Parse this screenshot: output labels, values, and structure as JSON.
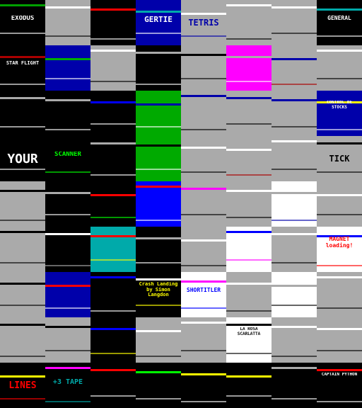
{
  "gallery": {
    "tiles": [
      {
        "label": "EXODUS",
        "bg": "#000000",
        "fg": "#ffffff",
        "accent": "#00a000",
        "size": 9
      },
      {
        "label": "",
        "bg": "#aaaaaa",
        "fg": "#000000",
        "accent": "#ffffff",
        "size": 6
      },
      {
        "label": "",
        "bg": "#000000",
        "fg": "#ffffff",
        "accent": "#ff0000",
        "size": 6
      },
      {
        "label": "GERTIE",
        "bg": "#0000aa",
        "fg": "#ffffff",
        "accent": "#00aaaa",
        "size": 11
      },
      {
        "label": "TETRIS",
        "bg": "#aaaaaa",
        "fg": "#0000aa",
        "accent": "#ffffff",
        "size": 12
      },
      {
        "label": "",
        "bg": "#aaaaaa",
        "fg": "#000000",
        "accent": "#ffffff",
        "size": 6
      },
      {
        "label": "",
        "bg": "#aaaaaa",
        "fg": "#000000",
        "accent": "#ffffff",
        "size": 6
      },
      {
        "label": "GENERAL",
        "bg": "#000000",
        "fg": "#ffffff",
        "accent": "#00aaaa",
        "size": 8
      },
      {
        "label": "STAR FLIGHT",
        "bg": "#000000",
        "fg": "#ffffff",
        "accent": "#aa0000",
        "size": 7
      },
      {
        "label": "",
        "bg": "#0000aa",
        "fg": "#ffffff",
        "accent": "#00aa00",
        "size": 6
      },
      {
        "label": "",
        "bg": "#aaaaaa",
        "fg": "#000000",
        "accent": "#ffffff",
        "size": 6
      },
      {
        "label": "",
        "bg": "#000000",
        "fg": "#ffffff",
        "accent": "#aaaaaa",
        "size": 6
      },
      {
        "label": "",
        "bg": "#aaaaaa",
        "fg": "#000000",
        "accent": "#000000",
        "size": 6
      },
      {
        "label": "",
        "bg": "#ff00ff",
        "fg": "#ffffff",
        "accent": "#aaaaaa",
        "size": 6
      },
      {
        "label": "",
        "bg": "#aaaaaa",
        "fg": "#aa0000",
        "accent": "#0000aa",
        "size": 6
      },
      {
        "label": "",
        "bg": "#aaaaaa",
        "fg": "#000000",
        "accent": "#ffffff",
        "size": 6
      },
      {
        "label": "",
        "bg": "#000000",
        "fg": "#ffffff",
        "accent": "#aaaaaa",
        "size": 6
      },
      {
        "label": "",
        "bg": "#000000",
        "fg": "#ffffff",
        "accent": "#aaaaaa",
        "size": 6
      },
      {
        "label": "",
        "bg": "#000000",
        "fg": "#ffffff",
        "accent": "#0000ff",
        "size": 6
      },
      {
        "label": "",
        "bg": "#00aa00",
        "fg": "#ffffff",
        "accent": "#0000aa",
        "size": 6
      },
      {
        "label": "",
        "bg": "#aaaaaa",
        "fg": "#000000",
        "accent": "#0000aa",
        "size": 6
      },
      {
        "label": "",
        "bg": "#aaaaaa",
        "fg": "#000000",
        "accent": "#0000aa",
        "size": 6
      },
      {
        "label": "",
        "bg": "#aaaaaa",
        "fg": "#000000",
        "accent": "#0000aa",
        "size": 6
      },
      {
        "label": "CONTROL DE STOCKS",
        "bg": "#0000aa",
        "fg": "#ffffff",
        "accent": "#ffff00",
        "size": 6
      },
      {
        "label": "YOUR",
        "bg": "#000000",
        "fg": "#ffffff",
        "accent": "#000000",
        "size": 18
      },
      {
        "label": "SCANNER",
        "bg": "#000000",
        "fg": "#00ff00",
        "accent": "#000000",
        "size": 9
      },
      {
        "label": "",
        "bg": "#000000",
        "fg": "#ffffff",
        "accent": "#aaaaaa",
        "size": 6
      },
      {
        "label": "",
        "bg": "#00aa00",
        "fg": "#ffffff",
        "accent": "#000000",
        "size": 6
      },
      {
        "label": "",
        "bg": "#aaaaaa",
        "fg": "#000000",
        "accent": "#ffffff",
        "size": 6
      },
      {
        "label": "",
        "bg": "#aaaaaa",
        "fg": "#aa0000",
        "accent": "#ffffff",
        "size": 6
      },
      {
        "label": "",
        "bg": "#aaaaaa",
        "fg": "#000000",
        "accent": "#ffffff",
        "size": 6
      },
      {
        "label": "TICK",
        "bg": "#aaaaaa",
        "fg": "#000000",
        "accent": "#000000",
        "size": 12
      },
      {
        "label": "",
        "bg": "#aaaaaa",
        "fg": "#000000",
        "accent": "#000000",
        "size": 6
      },
      {
        "label": "",
        "bg": "#000000",
        "fg": "#ffffff",
        "accent": "#aaaaaa",
        "size": 6
      },
      {
        "label": "",
        "bg": "#000000",
        "fg": "#00ff00",
        "accent": "#ff0000",
        "size": 6
      },
      {
        "label": "",
        "bg": "#0000ff",
        "fg": "#ffffff",
        "accent": "#ff0000",
        "size": 6
      },
      {
        "label": "",
        "bg": "#aaaaaa",
        "fg": "#000000",
        "accent": "#ff00ff",
        "size": 6
      },
      {
        "label": "",
        "bg": "#aaaaaa",
        "fg": "#000000",
        "accent": "#ffffff",
        "size": 6
      },
      {
        "label": "",
        "bg": "#ffffff",
        "fg": "#0000aa",
        "accent": "#aaaaaa",
        "size": 6
      },
      {
        "label": "",
        "bg": "#aaaaaa",
        "fg": "#000000",
        "accent": "#ffffff",
        "size": 6
      },
      {
        "label": "",
        "bg": "#aaaaaa",
        "fg": "#000000",
        "accent": "#000000",
        "size": 6
      },
      {
        "label": "",
        "bg": "#000000",
        "fg": "#aaaaaa",
        "accent": "#ffffff",
        "size": 6
      },
      {
        "label": "",
        "bg": "#00aaaa",
        "fg": "#ffff00",
        "accent": "#ff0000",
        "size": 6
      },
      {
        "label": "",
        "bg": "#000000",
        "fg": "#ffffff",
        "accent": "#aaaaaa",
        "size": 6
      },
      {
        "label": "",
        "bg": "#aaaaaa",
        "fg": "#000000",
        "accent": "#ffffff",
        "size": 6
      },
      {
        "label": "",
        "bg": "#ffffff",
        "fg": "#ff00ff",
        "accent": "#0000ff",
        "size": 6
      },
      {
        "label": "",
        "bg": "#aaaaaa",
        "fg": "#000000",
        "accent": "#ffffff",
        "size": 6
      },
      {
        "label": "MAGNET loading!",
        "bg": "#ffffff",
        "fg": "#ff0000",
        "accent": "#0000ff",
        "size": 8
      },
      {
        "label": "",
        "bg": "#aaaaaa",
        "fg": "#000000",
        "accent": "#000000",
        "size": 6
      },
      {
        "label": "",
        "bg": "#0000aa",
        "fg": "#ffffff",
        "accent": "#ff0000",
        "size": 6
      },
      {
        "label": "",
        "bg": "#000000",
        "fg": "#ffffff",
        "accent": "#0000ff",
        "size": 6
      },
      {
        "label": "Crash Landing by Simon Langdon",
        "bg": "#000000",
        "fg": "#ffff00",
        "accent": "#ffffff",
        "size": 7
      },
      {
        "label": "SHORTITLER",
        "bg": "#ffffff",
        "fg": "#0000ff",
        "accent": "#ff00ff",
        "size": 8
      },
      {
        "label": "",
        "bg": "#aaaaaa",
        "fg": "#000000",
        "accent": "#ffffff",
        "size": 6
      },
      {
        "label": "",
        "bg": "#ffffff",
        "fg": "#000000",
        "accent": "#aaaaaa",
        "size": 6
      },
      {
        "label": "",
        "bg": "#aaaaaa",
        "fg": "#000000",
        "accent": "#ffffff",
        "size": 6
      },
      {
        "label": "",
        "bg": "#aaaaaa",
        "fg": "#000000",
        "accent": "#000000",
        "size": 6
      },
      {
        "label": "",
        "bg": "#aaaaaa",
        "fg": "#000000",
        "accent": "#000000",
        "size": 6
      },
      {
        "label": "",
        "bg": "#000000",
        "fg": "#ffff00",
        "accent": "#0000ff",
        "size": 6
      },
      {
        "label": "",
        "bg": "#aaaaaa",
        "fg": "#000000",
        "accent": "#ffffff",
        "size": 6
      },
      {
        "label": "",
        "bg": "#aaaaaa",
        "fg": "#000000",
        "accent": "#ffffff",
        "size": 6
      },
      {
        "label": "LA ROSA SCARLATTA",
        "bg": "#ffffff",
        "fg": "#000000",
        "accent": "#000000",
        "size": 6
      },
      {
        "label": "",
        "bg": "#aaaaaa",
        "fg": "#000000",
        "accent": "#ffffff",
        "size": 6
      },
      {
        "label": "",
        "bg": "#aaaaaa",
        "fg": "#000000",
        "accent": "#ffffff",
        "size": 6
      },
      {
        "label": "LINES",
        "bg": "#000000",
        "fg": "#ff0000",
        "accent": "#ffff00",
        "size": 13
      },
      {
        "label": "+3 TAPE",
        "bg": "#000000",
        "fg": "#00aaaa",
        "accent": "#ff00ff",
        "size": 10
      },
      {
        "label": "",
        "bg": "#000000",
        "fg": "#ffffff",
        "accent": "#ff0000",
        "size": 6
      },
      {
        "label": "",
        "bg": "#000000",
        "fg": "#ffffff",
        "accent": "#00ff00",
        "size": 6
      },
      {
        "label": "",
        "bg": "#000000",
        "fg": "#ffffff",
        "accent": "#ffff00",
        "size": 6
      },
      {
        "label": "",
        "bg": "#000000",
        "fg": "#ffffff",
        "accent": "#ffff00",
        "size": 6
      },
      {
        "label": "",
        "bg": "#000000",
        "fg": "#ffffff",
        "accent": "#aaaaaa",
        "size": 6
      },
      {
        "label": "CAPTAIN PYTHON",
        "bg": "#000000",
        "fg": "#ffffff",
        "accent": "#ff0000",
        "size": 6
      }
    ]
  }
}
